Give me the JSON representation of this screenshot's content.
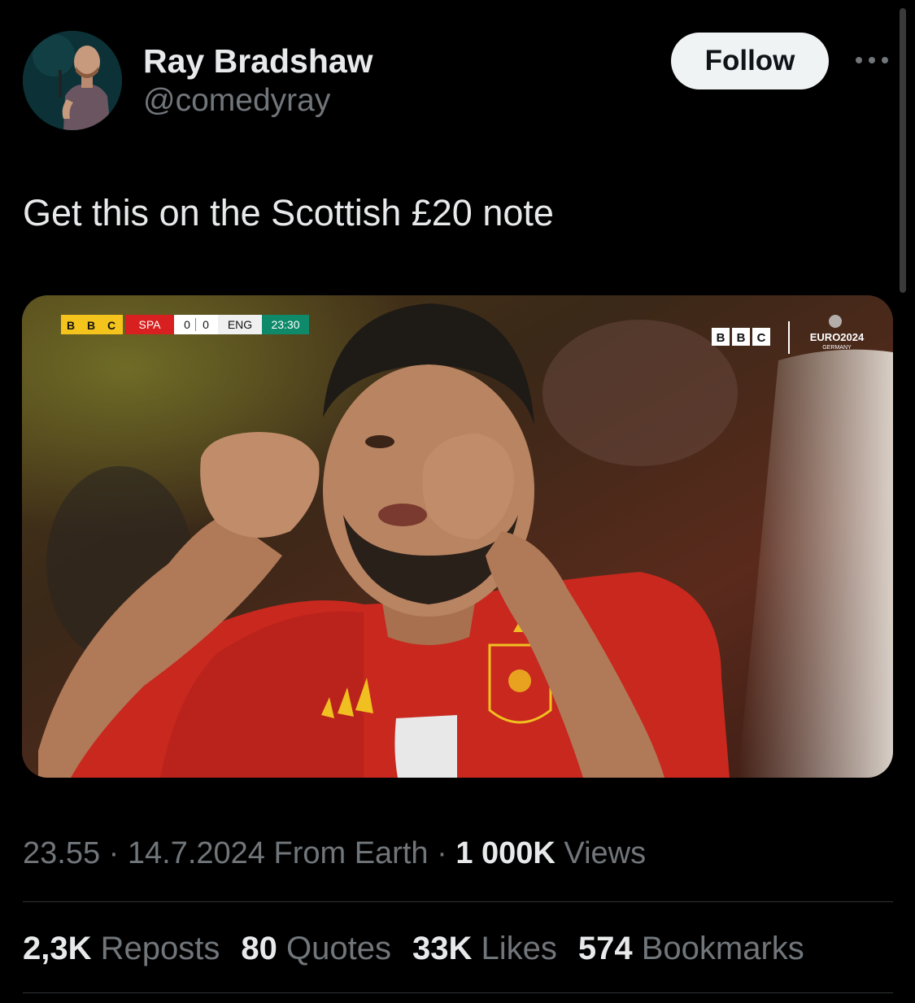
{
  "author": {
    "display_name": "Ray Bradshaw",
    "handle": "@comedyray"
  },
  "follow_label": "Follow",
  "tweet": {
    "text": "Get this on the Scottish £20 note"
  },
  "media": {
    "scoreboard": {
      "broadcaster": [
        "B",
        "B",
        "C"
      ],
      "home_team": "SPA",
      "home_score": "0",
      "away_score": "0",
      "away_team": "ENG",
      "clock": "23:30"
    },
    "corner": {
      "broadcaster": [
        "B",
        "B",
        "C"
      ],
      "tournament": "EURO2024",
      "host": "GERMANY"
    }
  },
  "meta": {
    "time": "23.55",
    "sep1": " · ",
    "date": "14.7.2024",
    "location": " From Earth",
    "sep2": " · ",
    "views_count": "1 000K",
    "views_label": " Views"
  },
  "stats": [
    {
      "count": "2,3K",
      "label": "Reposts"
    },
    {
      "count": "80",
      "label": "Quotes"
    },
    {
      "count": "33K",
      "label": "Likes"
    },
    {
      "count": "574",
      "label": "Bookmarks"
    }
  ],
  "colors": {
    "background": "#000000",
    "text_primary": "#e7e9ea",
    "text_secondary": "#71767b",
    "follow_bg": "#eff3f4",
    "divider": "#2f3336"
  },
  "icons": {
    "more": "more-horizontal-icon"
  }
}
